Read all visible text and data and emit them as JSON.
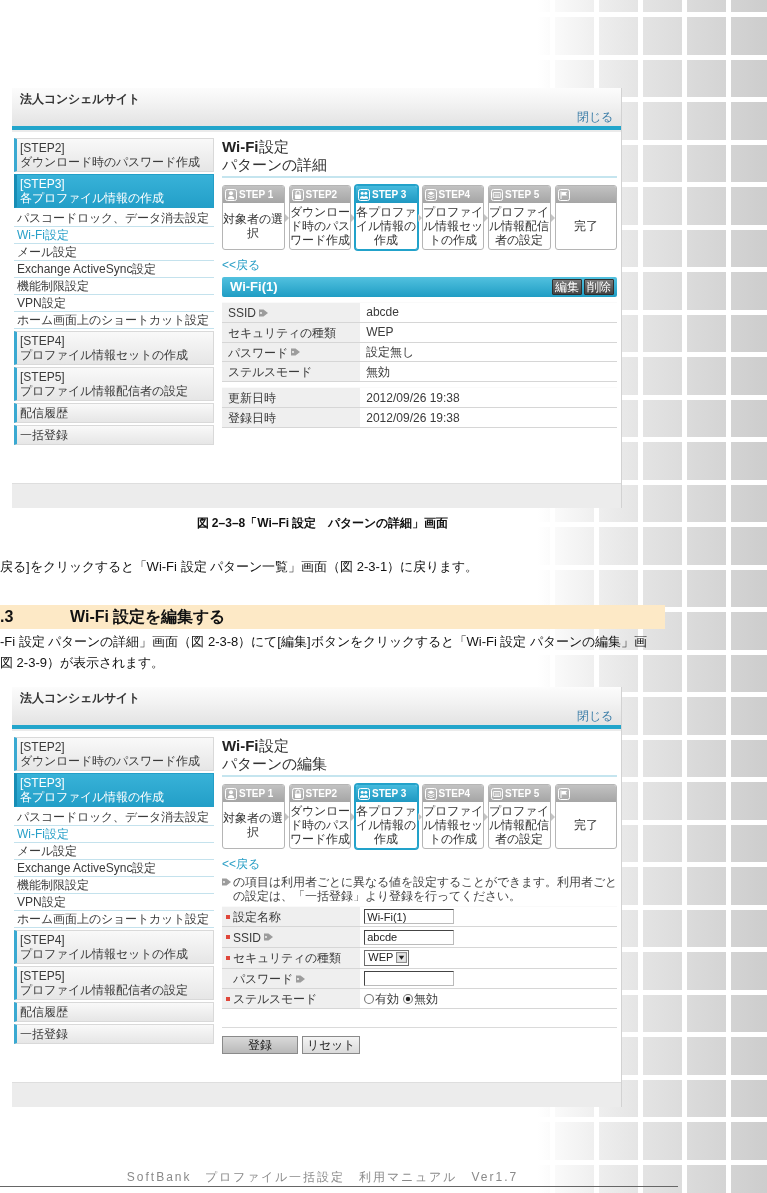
{
  "detail_screen": {
    "site_title": "法人コンシェルサイト",
    "close_link": "閉じる",
    "sidebar": [
      {
        "kind": "step",
        "step": "[STEP2]",
        "label": "ダウンロード時のパスワード作成",
        "selected": false
      },
      {
        "kind": "step",
        "step": "[STEP3]",
        "label": "各プロファイル情報の作成",
        "selected": true
      },
      {
        "kind": "link",
        "label": "パスコードロック、データ消去設定",
        "selected": false
      },
      {
        "kind": "link",
        "label": "Wi-Fi設定",
        "selected": true
      },
      {
        "kind": "link",
        "label": "メール設定",
        "selected": false
      },
      {
        "kind": "link",
        "label": "Exchange ActiveSync設定",
        "selected": false
      },
      {
        "kind": "link",
        "label": "機能制限設定",
        "selected": false
      },
      {
        "kind": "link",
        "label": "VPN設定",
        "selected": false
      },
      {
        "kind": "link",
        "label": "ホーム画面上のショートカット設定",
        "selected": false
      },
      {
        "kind": "step",
        "step": "[STEP4]",
        "label": "プロファイル情報セットの作成",
        "selected": false
      },
      {
        "kind": "step",
        "step": "[STEP5]",
        "label": "プロファイル情報配信者の設定",
        "selected": false
      },
      {
        "kind": "menu",
        "label": "配信履歴",
        "selected": false
      },
      {
        "kind": "menu",
        "label": "一括登録",
        "selected": false
      }
    ],
    "title": "**Wi-Fi**設定",
    "subtitle": "パターンの詳細",
    "steps": [
      {
        "label": "STEP 1",
        "caption": "対象者の選択",
        "selected": false
      },
      {
        "label": "STEP2",
        "caption": "ダウンロード時のパスワード作成",
        "selected": false
      },
      {
        "label": "STEP 3",
        "caption": "各プロファイル情報の作成",
        "selected": true
      },
      {
        "label": "STEP4",
        "caption": "プロファイル情報セットの作成",
        "selected": false
      },
      {
        "label": "STEP 5",
        "caption": "プロファイル情報配信者の設定",
        "selected": false
      },
      {
        "caption": "完了",
        "selected": false
      }
    ],
    "back_link": "<<戻る",
    "panel": {
      "title": "Wi-Fi(1)",
      "buttons": [
        "編集",
        "削除"
      ]
    },
    "settings": [
      {
        "label": "SSID",
        "tag": true,
        "value": "abcde"
      },
      {
        "label": "セキュリティの種類",
        "tag": false,
        "value": "WEP"
      },
      {
        "label": "パスワード",
        "tag": true,
        "value": "設定無し"
      },
      {
        "label": "ステルスモード",
        "tag": false,
        "value": "無効"
      }
    ],
    "timestamps": [
      {
        "label": "更新日時",
        "value": "2012/09/26 19:38"
      },
      {
        "label": "登録日時",
        "value": "2012/09/26 19:38"
      }
    ]
  },
  "figure_caption": "図 2–3–8「Wi–Fi 設定　パターンの詳細」画面",
  "paragraph_1": "戻る]をクリックすると「Wi-Fi 設定 パターン一覧」画面（図 2-3-1）に戻ります。",
  "section": {
    "number": ".3",
    "title": "Wi-Fi 設定を編集する"
  },
  "paragraph_2": [
    "-Fi 設定 パターンの詳細」画面（図 2-3-8）にて[編集]ボタンをクリックすると「Wi-Fi 設定 パターンの編集」画",
    "図 2-3-9）が表示されます。"
  ],
  "edit_screen": {
    "site_title": "法人コンシェルサイト",
    "close_link": "閉じる",
    "sidebar": [
      {
        "kind": "step",
        "step": "[STEP2]",
        "label": "ダウンロード時のパスワード作成",
        "selected": false
      },
      {
        "kind": "step",
        "step": "[STEP3]",
        "label": "各プロファイル情報の作成",
        "selected": true
      },
      {
        "kind": "link",
        "label": "パスコードロック、データ消去設定",
        "selected": false
      },
      {
        "kind": "link",
        "label": "Wi-Fi設定",
        "selected": true
      },
      {
        "kind": "link",
        "label": "メール設定",
        "selected": false
      },
      {
        "kind": "link",
        "label": "Exchange ActiveSync設定",
        "selected": false
      },
      {
        "kind": "link",
        "label": "機能制限設定",
        "selected": false
      },
      {
        "kind": "link",
        "label": "VPN設定",
        "selected": false
      },
      {
        "kind": "link",
        "label": "ホーム画面上のショートカット設定",
        "selected": false
      },
      {
        "kind": "step",
        "step": "[STEP4]",
        "label": "プロファイル情報セットの作成",
        "selected": false
      },
      {
        "kind": "step",
        "step": "[STEP5]",
        "label": "プロファイル情報配信者の設定",
        "selected": false
      },
      {
        "kind": "menu",
        "label": "配信履歴",
        "selected": false
      },
      {
        "kind": "menu",
        "label": "一括登録",
        "selected": false
      }
    ],
    "title": "**Wi-Fi**設定",
    "subtitle": "パターンの編集",
    "steps": [
      {
        "label": "STEP 1",
        "caption": "対象者の選択",
        "selected": false
      },
      {
        "label": "STEP2",
        "caption": "ダウンロード時のパスワード作成",
        "selected": false
      },
      {
        "label": "STEP 3",
        "caption": "各プロファイル情報の作成",
        "selected": true
      },
      {
        "label": "STEP4",
        "caption": "プロファイル情報セットの作成",
        "selected": false
      },
      {
        "label": "STEP 5",
        "caption": "プロファイル情報配信者の設定",
        "selected": false
      },
      {
        "caption": "完了",
        "selected": false
      }
    ],
    "back_link": "<<戻る",
    "note": "の項目は利用者ごとに異なる値を設定することができます。利用者ごとの設定は、「一括登録」より登録を行ってください。",
    "fields": [
      {
        "kind": "text",
        "label": "設定名称",
        "required": true,
        "tag": false,
        "value": "Wi-Fi(1)"
      },
      {
        "kind": "text",
        "label": "SSID",
        "required": true,
        "tag": true,
        "value": "abcde"
      },
      {
        "kind": "select",
        "label": "セキュリティの種類",
        "required": true,
        "tag": false,
        "value": "WEP"
      },
      {
        "kind": "text",
        "label": "パスワード",
        "required": false,
        "tag": true
      },
      {
        "kind": "radio",
        "label": "ステルスモード",
        "required": true,
        "tag": false,
        "options": [
          {
            "label": "有効",
            "selected": false
          },
          {
            "label": "無効",
            "selected": true
          }
        ]
      }
    ],
    "buttons": [
      "登録",
      "リセット"
    ]
  },
  "footer": "SoftBank　プロファイル一括設定　利用マニュアル　Ver1.7"
}
